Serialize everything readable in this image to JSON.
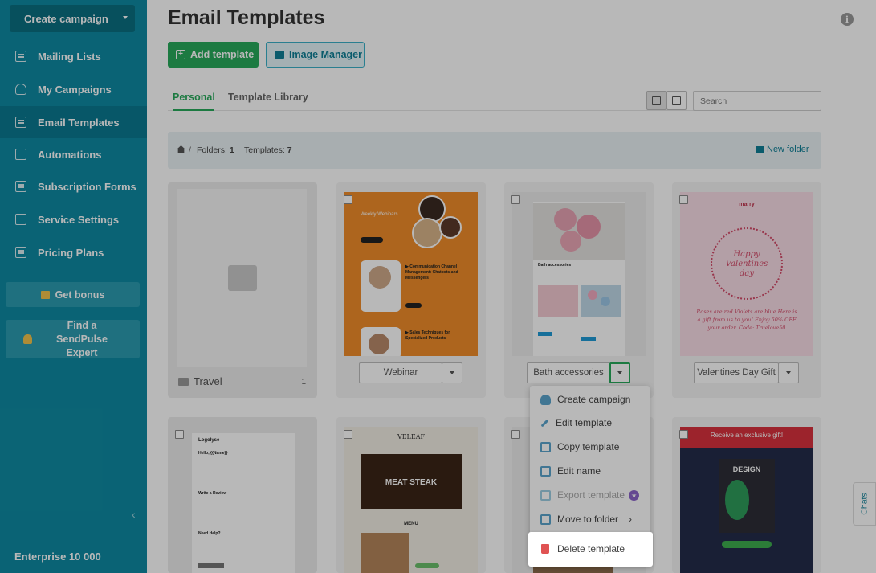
{
  "sidebar": {
    "create_button": "Create campaign",
    "items": [
      {
        "label": "Mailing Lists",
        "icon": "mailing-list-icon"
      },
      {
        "label": "My Campaigns",
        "icon": "campaign-icon"
      },
      {
        "label": "Email Templates",
        "icon": "template-icon"
      },
      {
        "label": "Automations",
        "icon": "automation-icon"
      },
      {
        "label": "Subscription Forms",
        "icon": "form-icon"
      },
      {
        "label": "Service Settings",
        "icon": "settings-icon"
      },
      {
        "label": "Pricing Plans",
        "icon": "pricing-icon"
      }
    ],
    "active_index": 2,
    "bonus_button": "Get bonus",
    "expert_button": "Find a SendPulse Expert",
    "plan": "Enterprise 10 000"
  },
  "header": {
    "title": "Email Templates",
    "add_template": "Add template",
    "image_manager": "Image Manager"
  },
  "tabs": {
    "personal": "Personal",
    "library": "Template Library"
  },
  "search": {
    "placeholder": "Search"
  },
  "breadcrumb": {
    "folders_label": "Folders:",
    "folders_count": "1",
    "templates_label": "Templates:",
    "templates_count": "7",
    "new_folder": "New folder"
  },
  "folder_card": {
    "name": "Travel",
    "count": "1"
  },
  "templates": [
    {
      "name": "Webinar"
    },
    {
      "name": "Bath accessories"
    },
    {
      "name": "Valentines Day Gift"
    }
  ],
  "thumb_texts": {
    "webinar_heading": "Weekly Webinars",
    "webinar_item1": "▶ Communication Channel Management: Chatbots and Messengers",
    "webinar_item2": "▶ Sales Techniques for Specialized Products",
    "bath_heading": "Bath accessories",
    "valentine_brand": "marry",
    "valentine_title": "Happy Valentines day",
    "valentine_poem": "Roses are red Violets are blue Here is a gift from us to you! Enjoy 50% OFF your order. Code: Truelove50",
    "logo_text": "Logolyse",
    "hello_text": "Hello, {{Name}}",
    "review_text": "Write a Review",
    "help_text": "Need Help?",
    "veleaf_logo": "VELEAF",
    "meat_steak": "MEAT STEAK",
    "menu_label": "MENU",
    "exclusive": "Receive an exclusive gift!",
    "design": "DESIGN"
  },
  "menu": {
    "items": [
      {
        "label": "Create campaign",
        "icon": "create-campaign-icon"
      },
      {
        "label": "Edit template",
        "icon": "pencil-icon"
      },
      {
        "label": "Copy template",
        "icon": "copy-icon"
      },
      {
        "label": "Edit name",
        "icon": "edit-name-icon"
      },
      {
        "label": "Export template",
        "icon": "export-icon"
      },
      {
        "label": "Move to folder",
        "icon": "move-folder-icon"
      }
    ],
    "delete": "Delete template"
  },
  "chats": "Chats",
  "colors": {
    "sidebar": "#0f8aa2",
    "accent_green": "#27a95b",
    "link_teal": "#0e7f96",
    "delete_red": "#e05353"
  }
}
